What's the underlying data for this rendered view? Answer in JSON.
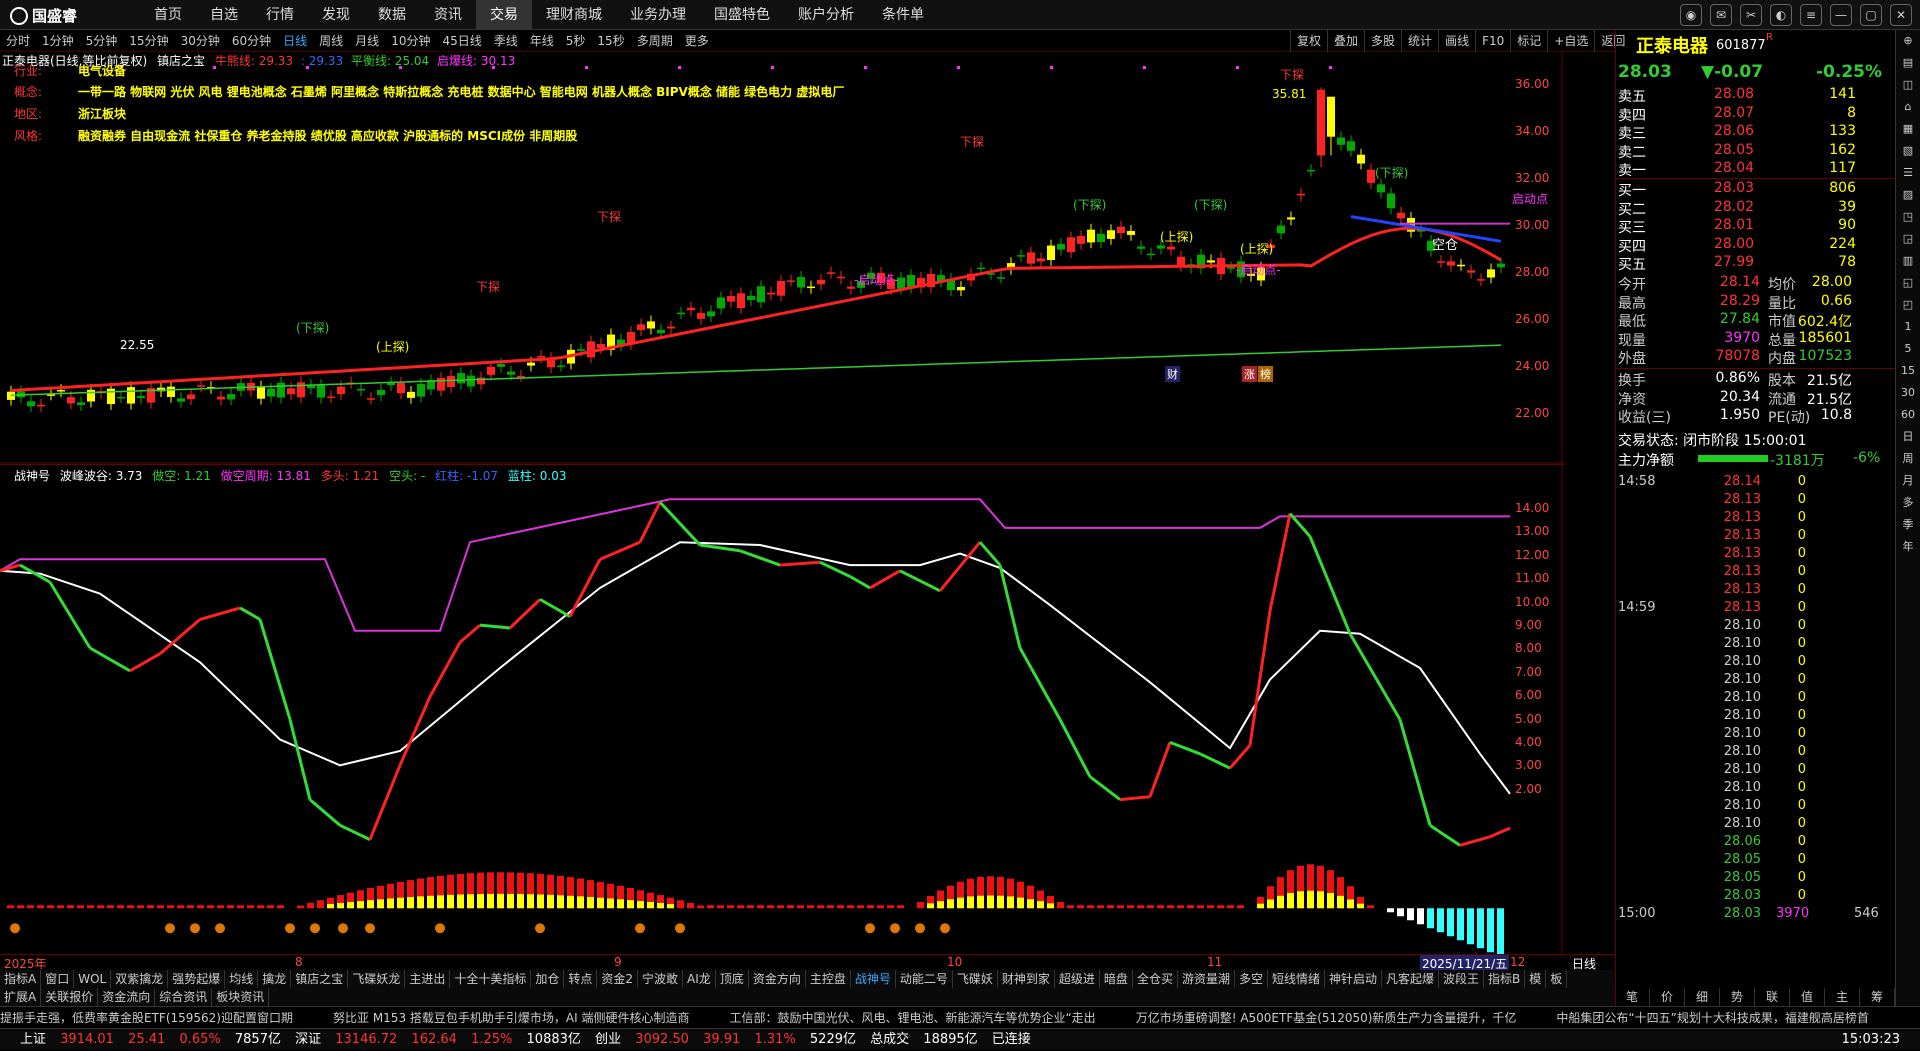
{
  "app": {
    "name": "国盛睿"
  },
  "menu": [
    "首页",
    "自选",
    "行情",
    "发现",
    "数据",
    "资讯",
    "交易",
    "理财商城",
    "业务办理",
    "国盛特色",
    "账户分析",
    "条件单"
  ],
  "periods": [
    "分时",
    "1分钟",
    "5分钟",
    "15分钟",
    "30分钟",
    "60分钟",
    "日线",
    "周线",
    "月线",
    "10分钟",
    "45日线",
    "季线",
    "年线",
    "5秒",
    "15秒",
    "多周期",
    "更多"
  ],
  "toolbar_right": [
    "复权",
    "叠加",
    "多股",
    "统计",
    "画线",
    "F10",
    "标记",
    "+自选",
    "返回"
  ],
  "chart_header": {
    "name": "正泰电器(日线,等比前复权)",
    "indicator": "镇店之宝",
    "line1": "牛熊线: 29.33",
    "line2": ": 29.33",
    "line3": "平衡线: 25.04",
    "line4": "启爆线: 30.13"
  },
  "stock_info": {
    "industry_label": "行业:",
    "industry": "电气设备",
    "concept_label": "概念:",
    "concept": "一带一路 物联网 光伏 风电 锂电池概念 石墨烯 阿里概念 特斯拉概念 充电桩 数据中心 智能电网 机器人概念 BIPV概念 储能 绿色电力 虚拟电厂",
    "region_label": "地区:",
    "region": "浙江板块",
    "style_label": "风格:",
    "style": "融资融券 自由现金流 社保重仓 养老金持股 绩优股 高应收款 沪股通标的 MSCI成份 非周期股"
  },
  "main_axis": [
    "36.00",
    "34.00",
    "32.00",
    "30.00",
    "28.00",
    "26.00",
    "24.00",
    "22.00"
  ],
  "annotations": {
    "high": "35.81",
    "low": "22.55",
    "xiatan": "下探",
    "xiatan_paren": "(下探)",
    "shangtan": "(上探)",
    "qidong": "-启动点-",
    "qidong_right": "启动点",
    "kongcang": "空仓",
    "cai": "财",
    "zhang": "涨",
    "bang": "榜"
  },
  "indicator_header": {
    "name": "战神号",
    "label1": "波峰波谷: 3.73",
    "label2": "做空: 1.21",
    "label3": "做空周期: 13.81",
    "label4": "多头: 1.21",
    "label5": "空头: -",
    "label6": "红柱: -1.07",
    "label7": "蓝柱: 0.03"
  },
  "ind_axis": [
    "14.00",
    "13.00",
    "12.00",
    "11.00",
    "10.00",
    "9.00",
    "8.00",
    "7.00",
    "6.00",
    "5.00",
    "4.00",
    "3.00",
    "2.00"
  ],
  "date_axis": {
    "d1": "2025年",
    "d2": "8",
    "d3": "9",
    "d4": "10",
    "d5": "11",
    "d6": "2025/11/21/五",
    "d7": "12",
    "period": "日线"
  },
  "tabs1": [
    "指标A",
    "窗口",
    "WOL",
    "双紫擒龙",
    "强势起爆",
    "均线",
    "擒龙",
    "镇店之宝",
    "飞碟妖龙",
    "主进出",
    "十全十美指标",
    "加仓",
    "转点",
    "资金2",
    "宁波敢",
    "AI龙",
    "顶底",
    "资金方向",
    "主控盘",
    "战神号",
    "动能二号",
    "飞碟妖",
    "财神到家",
    "超级进",
    "暗盘",
    "全仓买",
    "游资量潮",
    "多空",
    "短线情绪",
    "神针启动",
    "凡客起爆",
    "波段王",
    "指标B",
    "模",
    "板"
  ],
  "tabs2": [
    "扩展A",
    "关联报价",
    "资金流向",
    "综合资讯",
    "板块资讯"
  ],
  "news": [
    "提振手走强，低费率黄金股ETF(159562)迎配置窗口期",
    "努比亚 M153 搭载豆包手机助手引爆市场，AI 端侧硬件核心制造商",
    "工信部：鼓励中国光伏、风电、锂电池、新能源汽车等优势企业“走出",
    "万亿市场重磅调整! A500ETF基金(512050)新质生产力含量提升，千亿",
    "中船集团公布“十四五”规划十大科技成果，福建舰高居榜首"
  ],
  "status": {
    "sh_label": "上证",
    "sh_val": "3914.01",
    "sh_chg": "25.41",
    "sh_pct": "0.65%",
    "sh_amt": "7857亿",
    "sz_label": "深证",
    "sz_val": "13146.72",
    "sz_chg": "162.64",
    "sz_pct": "1.25%",
    "sz_amt": "10883亿",
    "cy_label": "创业",
    "cy_val": "3092.50",
    "cy_chg": "39.91",
    "cy_pct": "1.31%",
    "cy_amt": "5229亿",
    "total_label": "总成交",
    "total_amt": "18895亿",
    "conn": "已连接",
    "time": "15:03:23"
  },
  "quote": {
    "name": "正泰电器",
    "code": "601877",
    "badge": "R",
    "price": "28.03",
    "change": "▼-0.07",
    "pct": "-0.25%",
    "asks": [
      {
        "l": "卖五",
        "p": "28.08",
        "v": "141"
      },
      {
        "l": "卖四",
        "p": "28.07",
        "v": "8"
      },
      {
        "l": "卖三",
        "p": "28.06",
        "v": "133"
      },
      {
        "l": "卖二",
        "p": "28.05",
        "v": "162"
      },
      {
        "l": "卖一",
        "p": "28.04",
        "v": "117"
      }
    ],
    "bids": [
      {
        "l": "买一",
        "p": "28.03",
        "v": "806"
      },
      {
        "l": "买二",
        "p": "28.02",
        "v": "39"
      },
      {
        "l": "买三",
        "p": "28.01",
        "v": "90"
      },
      {
        "l": "买四",
        "p": "28.00",
        "v": "224"
      },
      {
        "l": "买五",
        "p": "27.99",
        "v": "78"
      }
    ],
    "stats": [
      {
        "k1": "今开",
        "v1": "28.14",
        "k2": "均价",
        "v2": "28.00"
      },
      {
        "k1": "最高",
        "v1": "28.29",
        "k2": "量比",
        "v2": "0.66"
      },
      {
        "k1": "最低",
        "v1": "27.84",
        "k2": "市值",
        "v2": "602.4亿"
      },
      {
        "k1": "现量",
        "v1": "3970",
        "k2": "总量",
        "v2": "185601"
      },
      {
        "k1": "外盘",
        "v1": "78078",
        "k2": "内盘",
        "v2": "107523"
      }
    ],
    "stats2": [
      {
        "k1": "换手",
        "v1": "0.86%",
        "k2": "股本",
        "v2": "21.5亿"
      },
      {
        "k1": "净资",
        "v1": "20.34",
        "k2": "流通",
        "v2": "21.5亿"
      },
      {
        "k1": "收益(三)",
        "v1": "1.950",
        "k2": "PE(动)",
        "v2": "10.8"
      }
    ],
    "trade_state_label": "交易状态:",
    "trade_state": "闭市阶段 15:00:01",
    "mainflow_label": "主力净额",
    "mainflow_val": "-3181万",
    "mainflow_pct": "-6%"
  },
  "ticks": [
    {
      "t": "14:58",
      "p": "28.14",
      "v": "0"
    },
    {
      "t": "",
      "p": "28.13",
      "v": "0"
    },
    {
      "t": "",
      "p": "28.13",
      "v": "0"
    },
    {
      "t": "",
      "p": "28.13",
      "v": "0"
    },
    {
      "t": "",
      "p": "28.13",
      "v": "0"
    },
    {
      "t": "",
      "p": "28.13",
      "v": "0"
    },
    {
      "t": "",
      "p": "28.13",
      "v": "0"
    },
    {
      "t": "14:59",
      "p": "28.13",
      "v": "0"
    },
    {
      "t": "",
      "p": "28.10",
      "v": "0"
    },
    {
      "t": "",
      "p": "28.10",
      "v": "0"
    },
    {
      "t": "",
      "p": "28.10",
      "v": "0"
    },
    {
      "t": "",
      "p": "28.10",
      "v": "0"
    },
    {
      "t": "",
      "p": "28.10",
      "v": "0"
    },
    {
      "t": "",
      "p": "28.10",
      "v": "0"
    },
    {
      "t": "",
      "p": "28.10",
      "v": "0"
    },
    {
      "t": "",
      "p": "28.10",
      "v": "0"
    },
    {
      "t": "",
      "p": "28.10",
      "v": "0"
    },
    {
      "t": "",
      "p": "28.10",
      "v": "0"
    },
    {
      "t": "",
      "p": "28.10",
      "v": "0"
    },
    {
      "t": "",
      "p": "28.10",
      "v": "0"
    },
    {
      "t": "",
      "p": "28.06",
      "v": "0"
    },
    {
      "t": "",
      "p": "28.05",
      "v": "0"
    },
    {
      "t": "",
      "p": "28.05",
      "v": "0"
    },
    {
      "t": "",
      "p": "28.03",
      "v": "0"
    },
    {
      "t": "15:00",
      "p": "28.03",
      "v": "3970",
      "last": "546"
    }
  ],
  "rbottom": [
    "笔",
    "价",
    "细",
    "势",
    "联",
    "值",
    "主",
    "筹"
  ],
  "sidebar": [
    "⊕",
    "▤",
    "◫",
    "⌂",
    "▦",
    "▧",
    "☰",
    "▨",
    "◳",
    "◲",
    "▥",
    "◱",
    "◰",
    "1",
    "5",
    "15",
    "30",
    "60",
    "日",
    "周",
    "月",
    "多",
    "季",
    "年"
  ]
}
